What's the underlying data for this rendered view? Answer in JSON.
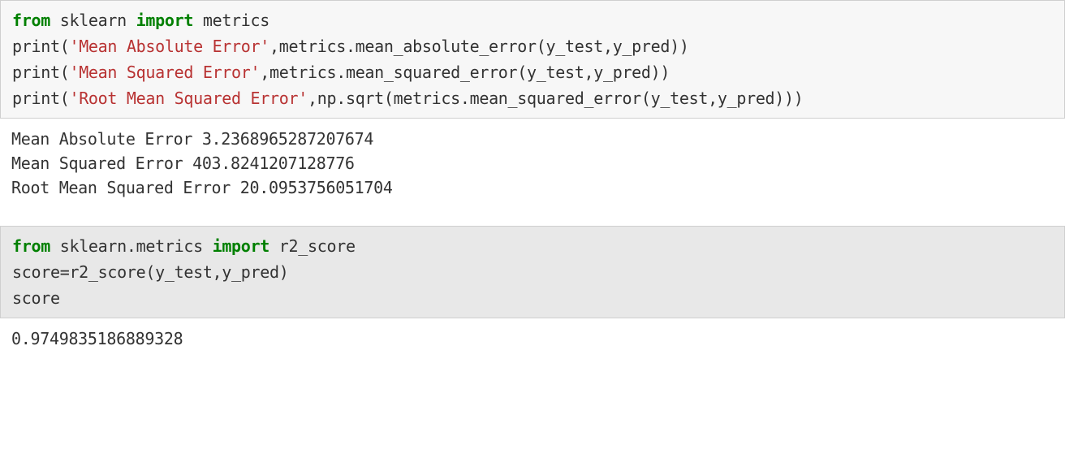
{
  "cell1": {
    "kw_from": "from",
    "module1": " sklearn ",
    "kw_import": "import",
    "module2": " metrics",
    "line2a": "print(",
    "line2b": "'Mean Absolute Error'",
    "line2c": ",metrics.mean_absolute_error(y_test,y_pred))",
    "line3a": "print(",
    "line3b": "'Mean Squared Error'",
    "line3c": ",metrics.mean_squared_error(y_test,y_pred))",
    "line4a": "print(",
    "line4b": "'Root Mean Squared Error'",
    "line4c": ",np.sqrt(metrics.mean_squared_error(y_test,y_pred)))"
  },
  "output1": {
    "line1": "Mean Absolute Error 3.2368965287207674",
    "line2": "Mean Squared Error 403.8241207128776",
    "line3": "Root Mean Squared Error 20.0953756051704"
  },
  "cell2": {
    "kw_from": "from",
    "module1": " sklearn.metrics ",
    "kw_import": "import",
    "module2": " r2_score",
    "line2": "score=r2_score(y_test,y_pred)",
    "line3": "score"
  },
  "output2": {
    "line1": "0.9749835186889328"
  }
}
